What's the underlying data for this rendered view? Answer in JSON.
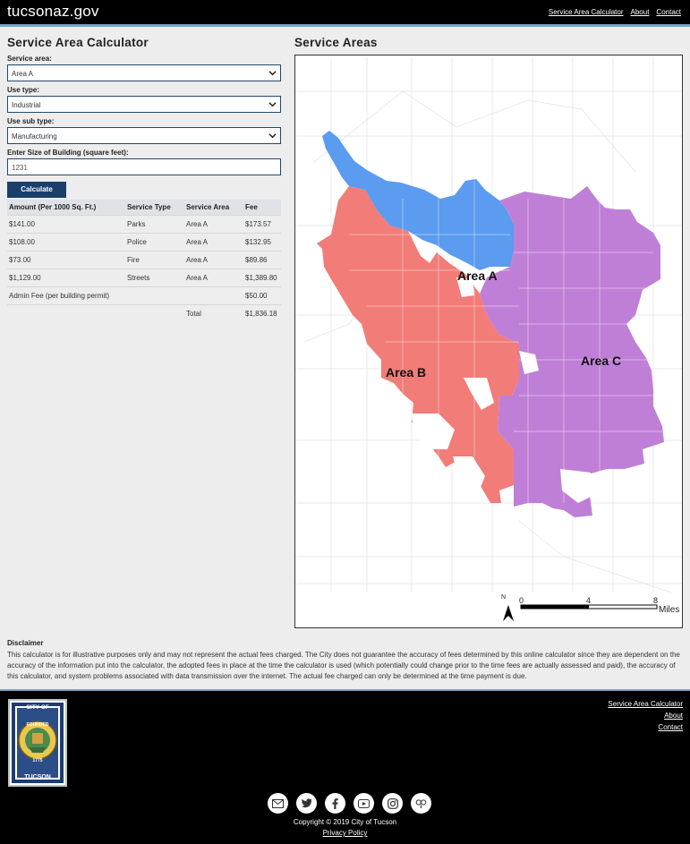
{
  "header": {
    "brand": "tucsonaz.gov",
    "nav": [
      "Service Area Calculator",
      "About",
      "Contact"
    ]
  },
  "calculator": {
    "title": "Service Area Calculator",
    "service_area_label": "Service area:",
    "service_area_value": "Area A",
    "use_type_label": "Use type:",
    "use_type_value": "Industrial",
    "use_sub_type_label": "Use sub type:",
    "use_sub_type_value": "Manufacturing",
    "size_label": "Enter Size of Building (square feet):",
    "size_value": "1231",
    "calculate_label": "Calculate",
    "table": {
      "headers": [
        "Amount (Per 1000 Sq. Ft.)",
        "Service Type",
        "Service Area",
        "Fee"
      ],
      "rows": [
        [
          "$141.00",
          "Parks",
          "Area A",
          "$173.57"
        ],
        [
          "$108.00",
          "Police",
          "Area A",
          "$132.95"
        ],
        [
          "$73.00",
          "Fire",
          "Area A",
          "$89.86"
        ],
        [
          "$1,129.00",
          "Streets",
          "Area A",
          "$1,389.80"
        ],
        [
          "Admin Fee (per building permit)",
          "",
          "",
          "$50.00"
        ],
        [
          "",
          "",
          "Total",
          "$1,836.18"
        ]
      ]
    }
  },
  "map_section": {
    "title": "Service Areas",
    "area_labels": [
      "Area A",
      "Area B",
      "Area C"
    ],
    "scale_ticks": [
      "0",
      "4",
      "8"
    ],
    "scale_unit": "Miles",
    "north": "N",
    "colors": {
      "area_a": "#5b9bf0",
      "area_b": "#f27c78",
      "area_c": "#c07fd6"
    }
  },
  "disclaimer": {
    "title": "Disclaimer",
    "text": "This calculator is for illustrative purposes only and may not represent the actual fees charged. The City does not guarantee the accuracy of fees determined by this online calculator since they are dependent on the accuracy of the information put into the calculator, the adopted fees in place at the time the calculator is used (which potentially could change prior to the time fees are actually assessed and paid), the accuracy of this calculator, and system problems associated with data transmission over the internet. The actual fee charged can only be determined at the time payment is due."
  },
  "footer": {
    "seal_lines": [
      "CITY OF",
      "FOUNDED",
      "1775",
      "TUCSON"
    ],
    "nav": [
      "Service Area Calculator",
      "About",
      "Contact"
    ],
    "social_icons": [
      "email-icon",
      "twitter-icon",
      "facebook-icon",
      "youtube-icon",
      "instagram-icon",
      "tripadvisor-icon"
    ],
    "copyright": "Copyright © 2019 City of Tucson",
    "privacy": "Privacy Policy"
  }
}
